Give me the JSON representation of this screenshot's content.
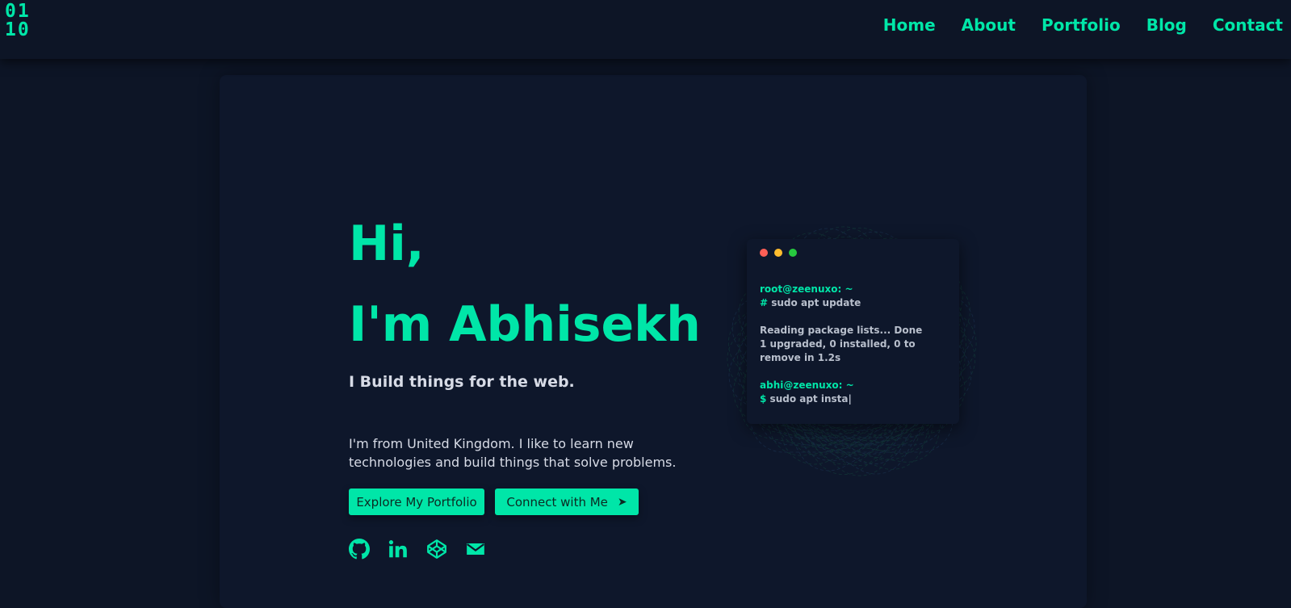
{
  "header": {
    "logo_line1": "01",
    "logo_line2": "10",
    "nav": [
      {
        "label": "Home"
      },
      {
        "label": "About"
      },
      {
        "label": "Portfolio"
      },
      {
        "label": "Blog"
      },
      {
        "label": "Contact"
      }
    ]
  },
  "hero": {
    "greeting": "Hi,",
    "name": "I'm Abhisekh",
    "tagline": "I Build things for the web.",
    "bio": "I'm from United Kingdom. I like to learn new technologies and build things that solve problems.",
    "primary_button": "Explore My Portfolio",
    "secondary_button": "Connect with Me",
    "send_icon": "➤",
    "socials": [
      {
        "icon": "github-icon"
      },
      {
        "icon": "linkedin-icon"
      },
      {
        "icon": "codepen-icon"
      },
      {
        "icon": "email-icon"
      }
    ]
  },
  "terminal": {
    "dots": [
      "#ff5f56",
      "#ffbd2e",
      "#27c93f"
    ],
    "user1": "root@zeenuxo: ~",
    "prompt1": "#",
    "cmd1": "sudo apt update",
    "out1": "Reading package lists... Done",
    "out2": "1 upgraded, 0 installed, 0 to remove in 1.2s",
    "user2": "abhi@zeenuxo: ~",
    "prompt2": "$",
    "cmd2": "sudo apt insta|"
  },
  "colors": {
    "accent": "#00e6a8",
    "background": "#0d1526",
    "card": "#0e172b",
    "text": "#d7dbe6"
  }
}
